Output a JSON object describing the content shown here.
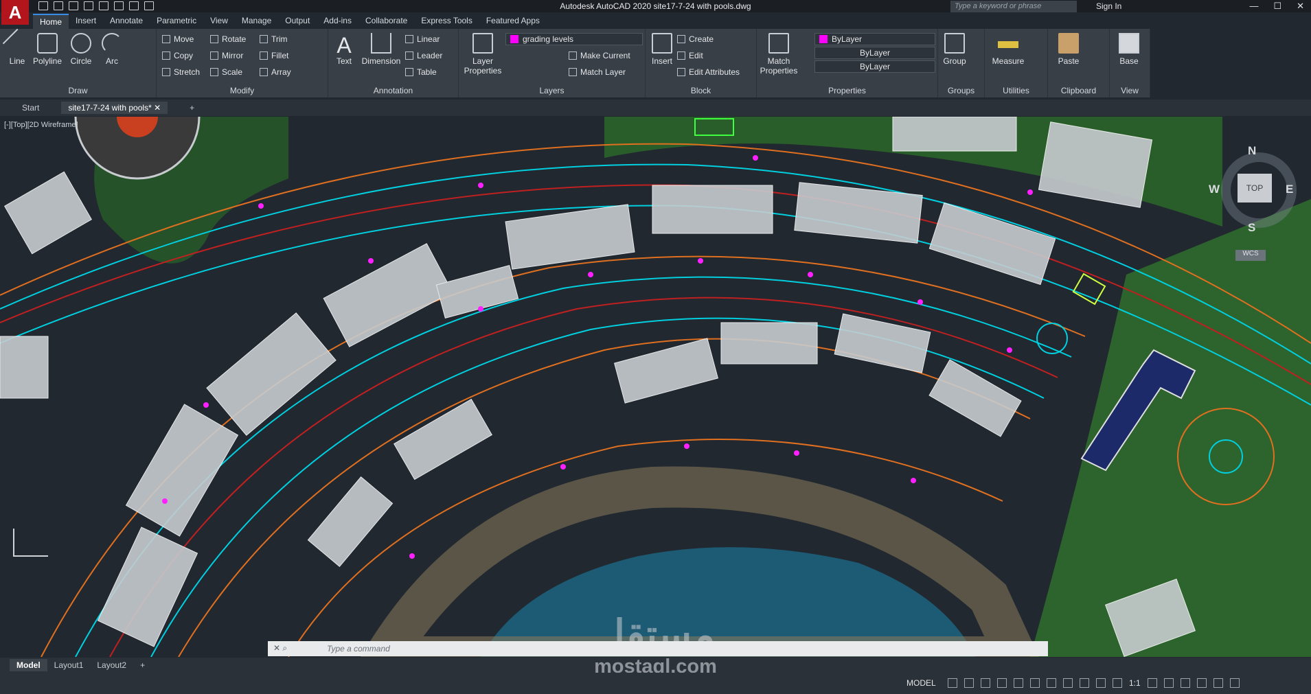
{
  "app": {
    "title": "Autodesk AutoCAD 2020    site17-7-24 with pools.dwg",
    "logo": "A",
    "search_placeholder": "Type a keyword or phrase",
    "sign_in": "Sign In"
  },
  "tabs": [
    "Home",
    "Insert",
    "Annotate",
    "Parametric",
    "View",
    "Manage",
    "Output",
    "Add-ins",
    "Collaborate",
    "Express Tools",
    "Featured Apps"
  ],
  "ribbon": {
    "draw": {
      "label": "Draw",
      "big": [
        "Line",
        "Polyline",
        "Circle",
        "Arc"
      ]
    },
    "modify": {
      "label": "Modify",
      "items": [
        "Move",
        "Rotate",
        "Trim",
        "Copy",
        "Mirror",
        "Fillet",
        "Stretch",
        "Scale",
        "Array"
      ]
    },
    "annotation": {
      "label": "Annotation",
      "big": [
        "Text",
        "Dimension"
      ],
      "items": [
        "Linear",
        "Leader",
        "Table"
      ]
    },
    "layers": {
      "label": "Layers",
      "big": "Layer Properties",
      "current_layer": "grading levels",
      "items": [
        "Make Current",
        "Match Layer"
      ]
    },
    "block": {
      "label": "Block",
      "big": "Insert",
      "items": [
        "Create",
        "Edit",
        "Edit Attributes"
      ]
    },
    "properties": {
      "label": "Properties",
      "big": "Match Properties",
      "color": "ByLayer",
      "linetype": "ByLayer",
      "lineweight": "ByLayer",
      "accent_color": "#ff00ff"
    },
    "groups": {
      "label": "Groups",
      "big": "Group"
    },
    "utilities": {
      "label": "Utilities",
      "big": "Measure"
    },
    "clipboard": {
      "label": "Clipboard",
      "big": "Paste"
    },
    "view": {
      "label": "View",
      "big": "Base"
    }
  },
  "doc_tabs": [
    "Start",
    "site17-7-24 with pools*"
  ],
  "viewport": {
    "label": "[-][Top][2D Wireframe]"
  },
  "viewcube": {
    "n": "N",
    "s": "S",
    "e": "E",
    "w": "W",
    "top": "TOP",
    "wcs": "WCS"
  },
  "command": {
    "placeholder": "Type  a  command"
  },
  "watermark": {
    "arabic": "مستقل",
    "latin": "mostaql.com"
  },
  "layout_tabs": [
    "Model",
    "Layout1",
    "Layout2"
  ],
  "status": {
    "model": "MODEL",
    "scale": "1:1"
  }
}
